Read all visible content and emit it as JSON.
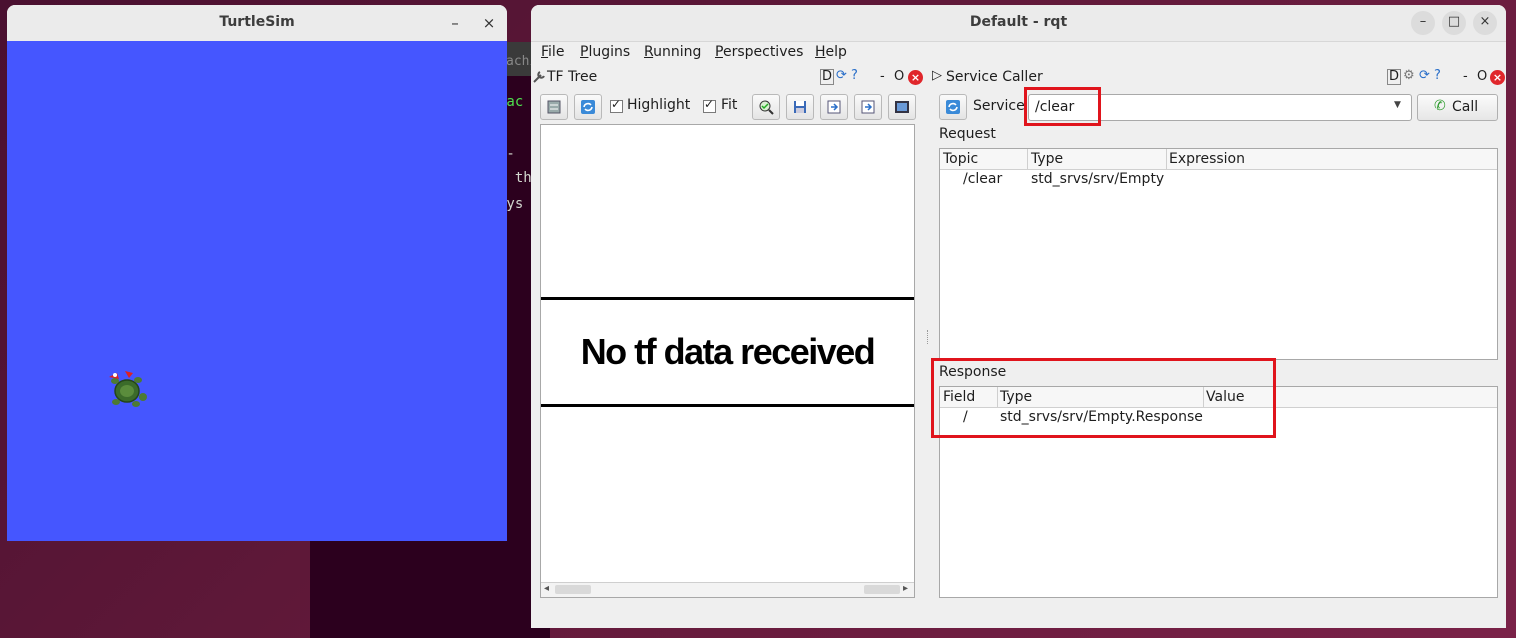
{
  "terminal": {
    "tab_fragment": "achi",
    "lines": [
      "mac",
      "--",
      "e th",
      "eys"
    ]
  },
  "turtlesim": {
    "title": "TurtleSim",
    "minimize": "–",
    "close": "×",
    "background_color": "#4556ff"
  },
  "rqt": {
    "title": "Default - rqt",
    "menu": [
      "File",
      "Plugins",
      "Running",
      "Perspectives",
      "Help"
    ],
    "tf_tree": {
      "title": "TF Tree",
      "dock_label": "D",
      "dock_minus": "-",
      "dock_o": "O",
      "highlight_label": "Highlight",
      "highlight_checked": true,
      "fit_label": "Fit",
      "fit_checked": true,
      "message": "No tf data received"
    },
    "service_caller": {
      "title": "Service Caller",
      "dock_label": "D",
      "dock_minus": "-",
      "dock_o": "O",
      "service_label": "Service",
      "service_value": "/clear",
      "call_label": "Call",
      "request_label": "Request",
      "request_columns": [
        "Topic",
        "Type",
        "Expression"
      ],
      "request_rows": [
        {
          "topic": "/clear",
          "type": "std_srvs/srv/Empty",
          "expression": ""
        }
      ],
      "response_label": "Response",
      "response_columns": [
        "Field",
        "Type",
        "Value"
      ],
      "response_rows": [
        {
          "field": "/",
          "type": "std_srvs/srv/Empty.Response",
          "value": ""
        }
      ]
    }
  },
  "colors": {
    "highlight_box": "#e0141c",
    "desktop": "#5e1838"
  }
}
